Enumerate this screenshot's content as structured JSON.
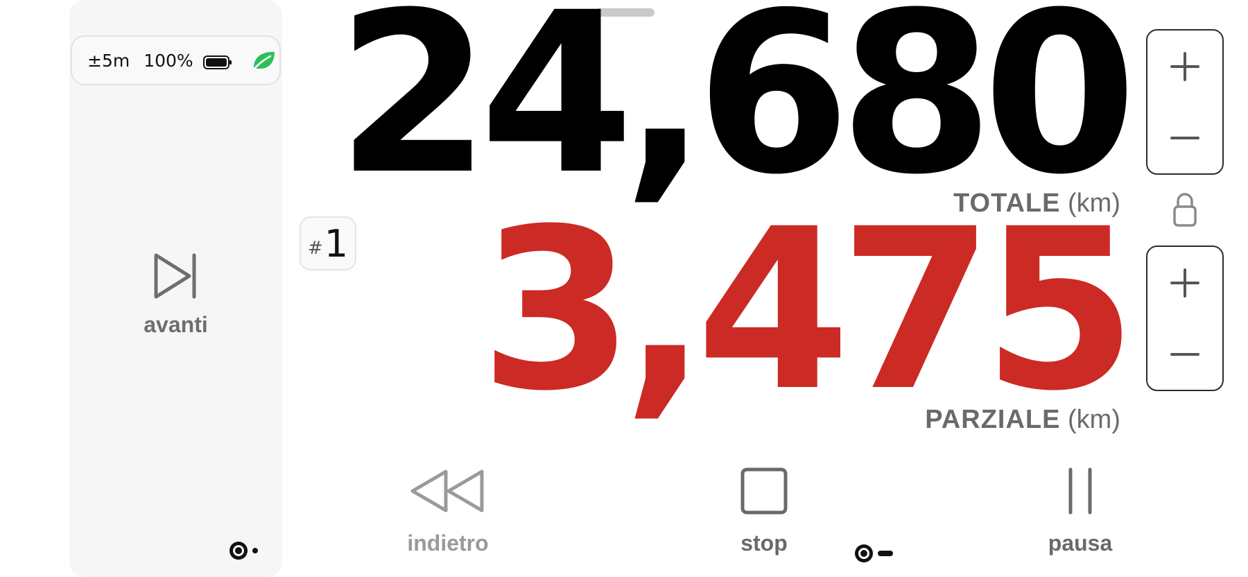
{
  "status": {
    "accuracy": "±5m",
    "battery_percent": "100%",
    "battery_icon": "battery-full-icon",
    "eco_icon": "leaf-icon",
    "eco_color": "#2fbf5a"
  },
  "sidebar": {
    "forward_label": "avanti",
    "forward_icon": "skip-forward-icon"
  },
  "trip": {
    "hash": "#",
    "number": "1"
  },
  "odometer": {
    "total_value": "24,680",
    "total_label": "TOTALE",
    "total_unit": "(km)",
    "partial_value": "3,475",
    "partial_label": "PARZIALE",
    "partial_unit": "(km)",
    "total_color": "#000000",
    "partial_color": "#cc2a24",
    "lock_icon": "lock-icon"
  },
  "controls": {
    "back_label": "indietro",
    "stop_label": "stop",
    "pause_label": "pausa",
    "back_icon": "rewind-icon",
    "stop_icon": "stop-icon",
    "pause_icon": "pause-icon"
  }
}
